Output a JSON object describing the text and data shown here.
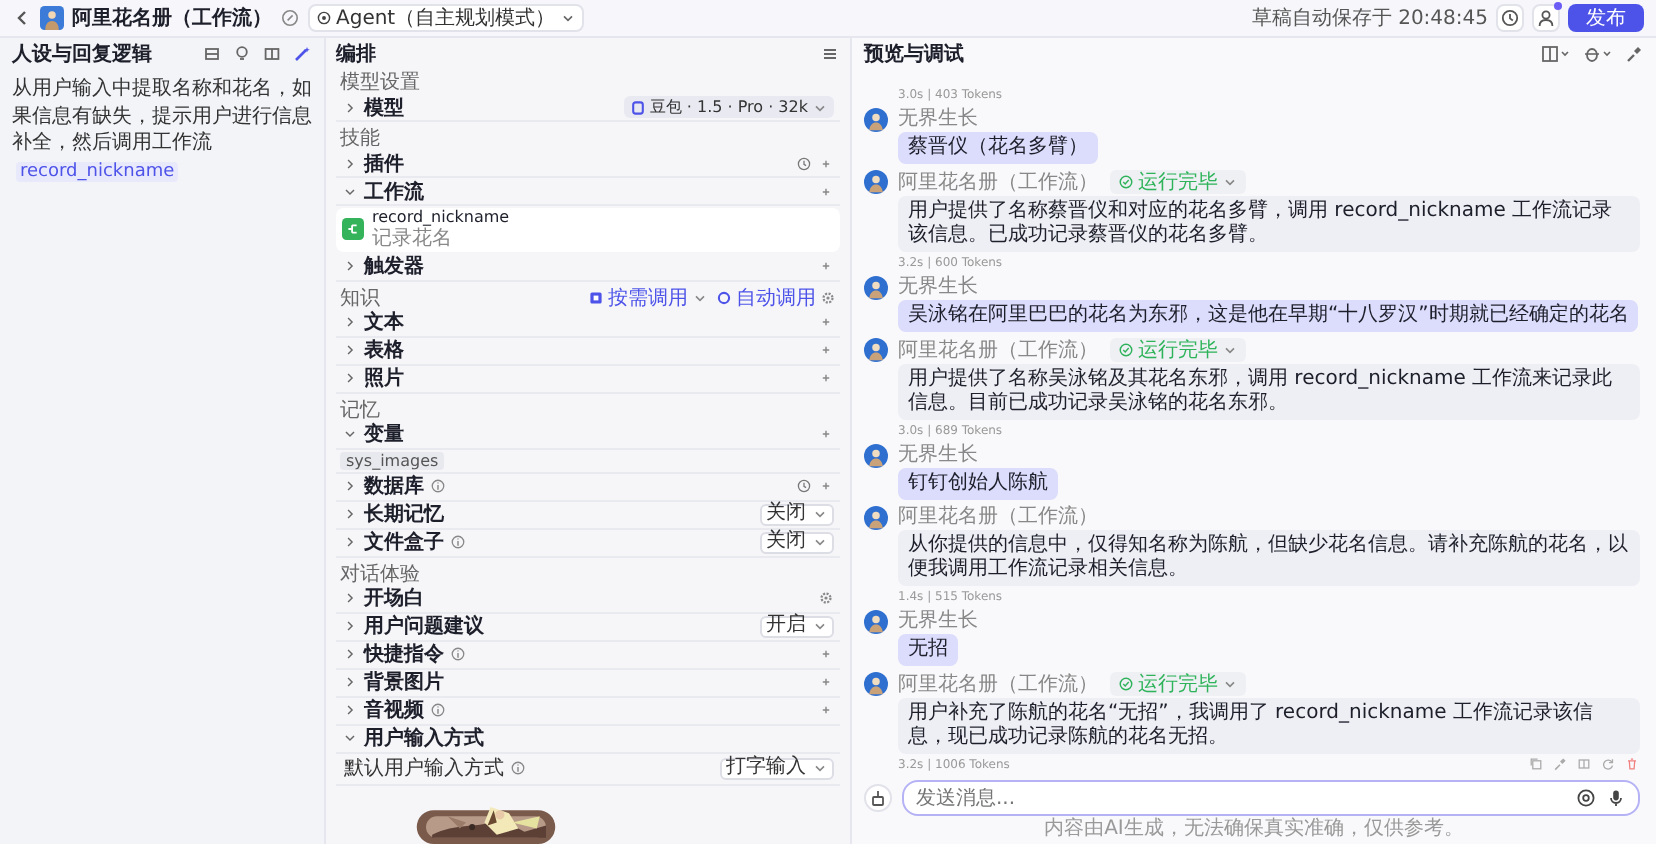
{
  "app_bar": {
    "title": "阿里花名册（工作流）",
    "mode": "Agent（自主规划模式）",
    "save_status": "草稿自动保存于 20:48:45",
    "publish": "发布",
    "has_notification": true
  },
  "persona": {
    "title": "人设与回复逻辑",
    "prompt": "从用户输入中提取名称和花名，如果信息有缺失，提示用户进行信息补全，然后调用工作流",
    "prompt_tag": "record_nickname"
  },
  "orchestration": {
    "title": "编排",
    "sections": [
      {
        "label": "模型设置",
        "rows": [
          {
            "label": "模型",
            "kind": "model",
            "info": false,
            "value": "豆包 · 1.5 · Pro · 32k",
            "expanded": false
          }
        ]
      },
      {
        "label": "技能",
        "rows": [
          {
            "label": "插件",
            "kind": "auto_add",
            "info": false,
            "expanded": false
          },
          {
            "label": "工作流",
            "kind": "add",
            "info": false,
            "expanded": true,
            "items": [
              {
                "name": "record_nickname",
                "description": "记录花名"
              }
            ]
          },
          {
            "label": "触发器",
            "kind": "add",
            "info": false,
            "expanded": false
          }
        ]
      },
      {
        "label": "知识",
        "controls": [
          {
            "kind": "dropdown",
            "label": "按需调用"
          },
          {
            "kind": "settings",
            "label": "自动调用"
          }
        ],
        "rows": [
          {
            "label": "文本",
            "kind": "add",
            "info": false,
            "expanded": false
          },
          {
            "label": "表格",
            "kind": "add",
            "info": false,
            "expanded": false
          },
          {
            "label": "照片",
            "kind": "add",
            "info": false,
            "expanded": false
          }
        ]
      },
      {
        "label": "记忆",
        "rows": [
          {
            "label": "变量",
            "kind": "add",
            "info": false,
            "expanded": true,
            "tags": [
              "sys_images"
            ]
          },
          {
            "label": "数据库",
            "kind": "auto_add",
            "info": true,
            "expanded": false
          },
          {
            "label": "长期记忆",
            "kind": "select",
            "info": false,
            "value": "关闭",
            "expanded": false
          },
          {
            "label": "文件盒子",
            "kind": "select",
            "info": true,
            "value": "关闭",
            "expanded": false
          }
        ]
      },
      {
        "label": "对话体验",
        "rows": [
          {
            "label": "开场白",
            "kind": "settings",
            "info": false,
            "expanded": false
          },
          {
            "label": "用户问题建议",
            "kind": "select",
            "info": false,
            "value": "开启",
            "expanded": false
          },
          {
            "label": "快捷指令",
            "kind": "add",
            "info": true,
            "expanded": false
          },
          {
            "label": "背景图片",
            "kind": "add",
            "info": false,
            "expanded": false
          },
          {
            "label": "音视频",
            "kind": "add",
            "info": true,
            "expanded": false
          },
          {
            "label": "用户输入方式",
            "kind": "none",
            "info": false,
            "expanded": true,
            "fields": [
              {
                "label": "默认用户输入方式",
                "info": true,
                "value": "打字输入"
              }
            ]
          }
        ]
      }
    ]
  },
  "preview": {
    "title": "预览与调试",
    "messages": [
      {
        "meta": "3.0s | 403 Tokens",
        "actions": false
      },
      {
        "kind": "user",
        "name": "无界生长",
        "text": "蔡晋仪（花名多臂）"
      },
      {
        "kind": "bot",
        "name": "阿里花名册（工作流）",
        "status": "运行完毕",
        "text": "用户提供了名称蔡晋仪和对应的花名多臂，调用 record_nickname 工作流记录该信息。已成功记录蔡晋仪的花名多臂。",
        "meta": "3.2s | 600 Tokens",
        "actions": false
      },
      {
        "kind": "user",
        "name": "无界生长",
        "text": "吴泳铭在阿里巴巴的花名为东邪，这是他在早期“十八罗汉”时期就已经确定的花名"
      },
      {
        "kind": "bot",
        "name": "阿里花名册（工作流）",
        "status": "运行完毕",
        "text": "用户提供了名称吴泳铭及其花名东邪，调用 record_nickname 工作流来记录此信息。目前已成功记录吴泳铭的花名东邪。",
        "meta": "3.0s | 689 Tokens",
        "actions": false
      },
      {
        "kind": "user",
        "name": "无界生长",
        "text": "钉钉创始人陈航"
      },
      {
        "kind": "bot",
        "name": "阿里花名册（工作流）",
        "text": "从你提供的信息中，仅得知名称为陈航，但缺少花名信息。请补充陈航的花名，以便我调用工作流记录相关信息。",
        "meta": "1.4s | 515 Tokens",
        "actions": false
      },
      {
        "kind": "user",
        "name": "无界生长",
        "text": "无招"
      },
      {
        "kind": "bot",
        "name": "阿里花名册（工作流）",
        "status": "运行完毕",
        "text": "用户补充了陈航的花名“无招”，我调用了 record_nickname 工作流记录该信息，现已成功记录陈航的花名无招。",
        "meta": "3.2s | 1006 Tokens",
        "actions": true
      }
    ],
    "input": {
      "placeholder": "发送消息..."
    },
    "disclaimer": "内容由AI生成，无法确保真实准确，仅供参考。"
  }
}
